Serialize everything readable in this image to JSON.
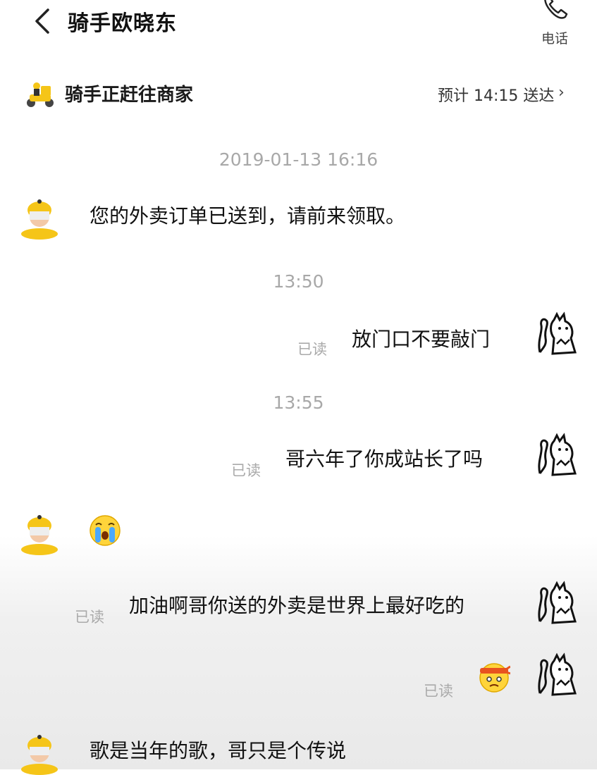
{
  "header": {
    "title": "骑手欧晓东",
    "phone_label": "电话"
  },
  "status": {
    "text": "骑手正赶往商家",
    "eta": "预计 14:15 送达",
    "chevron": "›"
  },
  "colors": {
    "rider_yellow": "#f5c518",
    "read_gray": "#aaaaaa",
    "timestamp_gray": "#a8a8a8"
  },
  "messages": {
    "ts1": "2019-01-13 16:16",
    "m1": "您的外卖订单已送到，请前来领取。",
    "ts2": "13:50",
    "m2": "放门口不要敲门",
    "m2_read": "已读",
    "ts3": "13:55",
    "m3": "哥六年了你成站长了吗",
    "m3_read": "已读",
    "m4_emoji": "crying-face-emoji",
    "m5": "加油啊哥你送的外卖是世界上最好吃的",
    "m5_read": "已读",
    "m6_emoji": "headband-face-emoji",
    "m6_read": "已读",
    "m7": "歌是当年的歌，哥只是个传说"
  }
}
